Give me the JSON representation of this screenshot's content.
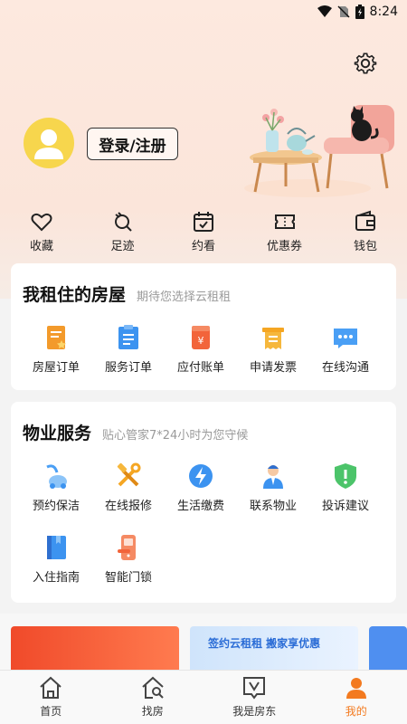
{
  "status_bar": {
    "time": "8:24"
  },
  "profile": {
    "login_label": "登录/注册"
  },
  "quick_actions": [
    {
      "label": "收藏",
      "icon": "heart-icon"
    },
    {
      "label": "足迹",
      "icon": "footprint-icon"
    },
    {
      "label": "约看",
      "icon": "calendar-icon"
    },
    {
      "label": "优惠券",
      "icon": "coupon-icon"
    },
    {
      "label": "钱包",
      "icon": "wallet-icon"
    }
  ],
  "rent_section": {
    "title": "我租住的房屋",
    "subtitle": "期待您选择云租租",
    "items": [
      {
        "label": "房屋订单",
        "icon": "house-order-icon"
      },
      {
        "label": "服务订单",
        "icon": "service-order-icon"
      },
      {
        "label": "应付账单",
        "icon": "bill-icon"
      },
      {
        "label": "申请发票",
        "icon": "invoice-icon"
      },
      {
        "label": "在线沟通",
        "icon": "chat-icon"
      }
    ]
  },
  "property_section": {
    "title": "物业服务",
    "subtitle": "贴心管家7*24小时为您守候",
    "items": [
      {
        "label": "预约保洁",
        "icon": "vacuum-icon"
      },
      {
        "label": "在线报修",
        "icon": "repair-tools-icon"
      },
      {
        "label": "生活缴费",
        "icon": "utility-bolt-icon"
      },
      {
        "label": "联系物业",
        "icon": "property-staff-icon"
      },
      {
        "label": "投诉建议",
        "icon": "shield-alert-icon"
      },
      {
        "label": "入住指南",
        "icon": "guide-book-icon"
      },
      {
        "label": "智能门锁",
        "icon": "smart-lock-icon"
      }
    ]
  },
  "banners": [
    {
      "text": ""
    },
    {
      "text": "签约云租租 搬家享优惠"
    },
    {
      "text": ""
    }
  ],
  "tabs": [
    {
      "label": "首页",
      "icon": "home-icon"
    },
    {
      "label": "找房",
      "icon": "find-house-icon"
    },
    {
      "label": "我是房东",
      "icon": "landlord-icon"
    },
    {
      "label": "我的",
      "icon": "profile-icon",
      "active": true
    }
  ],
  "colors": {
    "accent": "#f37a1f",
    "header_bg": "#fbe5da",
    "avatar_bg": "#f7d64d"
  }
}
